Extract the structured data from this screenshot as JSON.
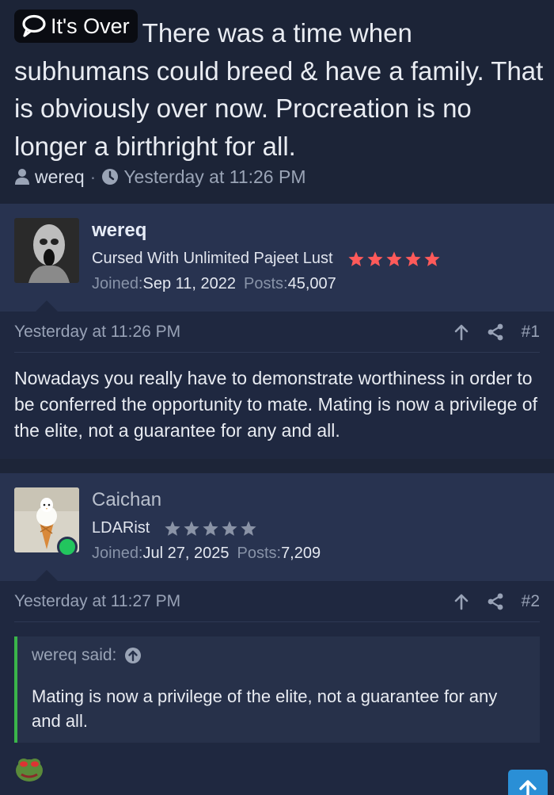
{
  "thread": {
    "prefix": "It's Over",
    "title": "There was a time when subhumans could breed & have a family. That is obviously over now. Procreation is no longer a birthright for all.",
    "author": "wereq",
    "time": "Yesterday at 11:26 PM"
  },
  "posts": [
    {
      "username": "wereq",
      "user_title": "Cursed With Unlimited Pajeet Lust",
      "stars_color": "#ff5a5a",
      "joined_label": "Joined:",
      "joined": "Sep 11, 2022",
      "posts_label": "Posts:",
      "posts_count": "45,007",
      "date": "Yesterday at 11:26 PM",
      "number": "#1",
      "text": "Nowadays you really have to demonstrate worthiness in order to be conferred the opportunity to mate. Mating is now a privilege of the elite, not a guarantee for any and all."
    },
    {
      "username": "Caichan",
      "user_title": "LDARist",
      "stars_color": "#8a93a6",
      "joined_label": "Joined:",
      "joined": "Jul 27, 2025",
      "posts_label": "Posts:",
      "posts_count": "7,209",
      "date": "Yesterday at 11:27 PM",
      "number": "#2",
      "quote": {
        "author": "wereq said:",
        "text": "Mating is now a privilege of the elite, not a guarantee for any and all."
      }
    }
  ],
  "icons": {
    "prefix": "speech-bubble-icon",
    "user": "user-icon",
    "clock": "clock-icon",
    "up": "arrow-up-icon",
    "share": "share-icon",
    "scroll": "chevron-up-icon"
  }
}
